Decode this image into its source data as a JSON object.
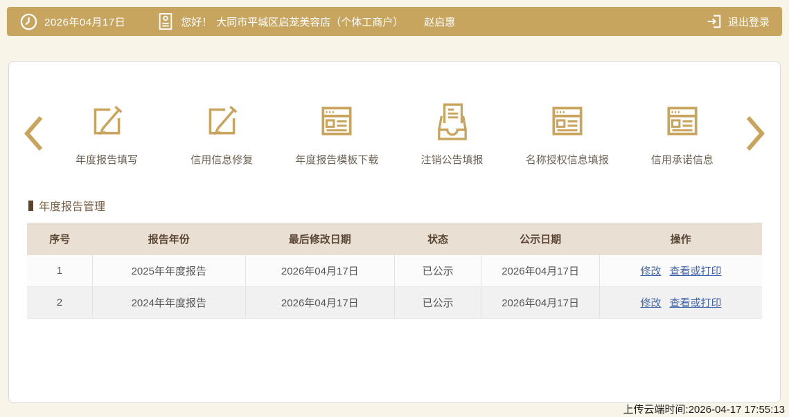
{
  "topbar": {
    "date": "2026年04月17日",
    "greeting": "您好！",
    "company": "大同市平城区启茏美容店（个体工商户）",
    "user_name": "赵启惠",
    "logout_label": "退出登录"
  },
  "colors": {
    "bar_gold": "#C7A55E",
    "icon_gold": "#C9A45D",
    "page_background": "#F8F4E7",
    "table_header_bg": "#E9DFD2",
    "section_title_brown": "#7d6347",
    "link_blue": "#3E64AD"
  },
  "icons": {
    "topbar": [
      "clock-icon",
      "id-badge-icon",
      "logout-icon"
    ],
    "carousel": [
      "chevron-left-icon",
      "chevron-right-icon"
    ]
  },
  "menu": {
    "items": [
      {
        "label": "年度报告填写",
        "icon": "edit-icon"
      },
      {
        "label": "信用信息修复",
        "icon": "edit-icon"
      },
      {
        "label": "年度报告模板下载",
        "icon": "webpage-icon"
      },
      {
        "label": "注销公告填报",
        "icon": "inbox-document-icon"
      },
      {
        "label": "名称授权信息填报",
        "icon": "webpage-icon"
      },
      {
        "label": "信用承诺信息",
        "icon": "webpage-icon"
      }
    ]
  },
  "section": {
    "title": "年度报告管理"
  },
  "table": {
    "headers": [
      "序号",
      "报告年份",
      "最后修改日期",
      "状态",
      "公示日期",
      "操作"
    ],
    "rows": [
      {
        "no": "1",
        "year": "2025年年度报告",
        "modified": "2026年04月17日",
        "status": "已公示",
        "publish_date": "2026年04月17日",
        "actions": [
          "修改",
          "查看或打印"
        ]
      },
      {
        "no": "2",
        "year": "2024年年度报告",
        "modified": "2026年04月17日",
        "status": "已公示",
        "publish_date": "2026年04月17日",
        "actions": [
          "修改",
          "查看或打印"
        ]
      }
    ]
  },
  "footer": {
    "upload_time": "上传云端时间:2026-04-17 17:55:13"
  }
}
